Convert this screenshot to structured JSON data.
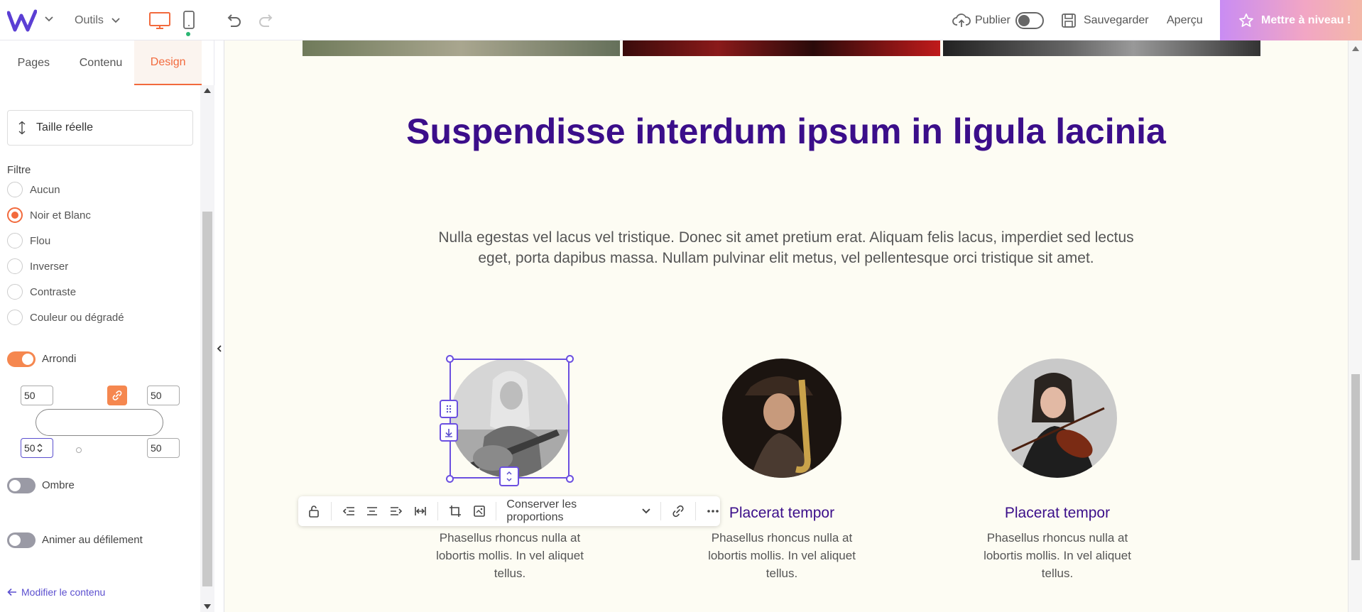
{
  "topbar": {
    "tools_label": "Outils",
    "publish_label": "Publier",
    "save_label": "Sauvegarder",
    "preview_label": "Aperçu",
    "upgrade_label": "Mettre à niveau !"
  },
  "panel": {
    "tabs": [
      {
        "label": "Pages"
      },
      {
        "label": "Contenu"
      },
      {
        "label": "Design"
      }
    ],
    "size_label": "Taille réelle",
    "filter_title": "Filtre",
    "filters": [
      {
        "label": "Aucun"
      },
      {
        "label": "Noir et Blanc"
      },
      {
        "label": "Flou"
      },
      {
        "label": "Inverser"
      },
      {
        "label": "Contraste"
      },
      {
        "label": "Couleur ou dégradé"
      }
    ],
    "rounded_label": "Arrondi",
    "radius": {
      "top_left": "50",
      "top_right": "50",
      "bottom_left": "50",
      "bottom_right": "50"
    },
    "shadow_label": "Ombre",
    "animate_label": "Animer au défilement",
    "modify_label": "Modifier le contenu"
  },
  "canvas": {
    "headline": "Suspendisse interdum ipsum in ligula lacinia",
    "intro": "Nulla egestas vel lacus vel tristique. Donec sit amet pretium erat. Aliquam felis lacus, imperdiet sed lectus eget, porta dapibus massa. Nullam pulvinar elit metus, vel pellentesque orci tristique sit amet.",
    "cards": [
      {
        "title": "",
        "text": "Phasellus rhoncus nulla at lobortis mollis. In vel aliquet tellus."
      },
      {
        "title": "Placerat tempor",
        "text": "Phasellus rhoncus nulla at lobortis mollis. In vel aliquet tellus."
      },
      {
        "title": "Placerat tempor",
        "text": "Phasellus rhoncus nulla at lobortis mollis. In vel aliquet tellus."
      }
    ],
    "toolbar": {
      "proportions_label": "Conserver les proportions"
    }
  },
  "colors": {
    "accent": "#f26a3d",
    "brand_purple": "#3b0e8a",
    "selection": "#6b4fe0"
  }
}
